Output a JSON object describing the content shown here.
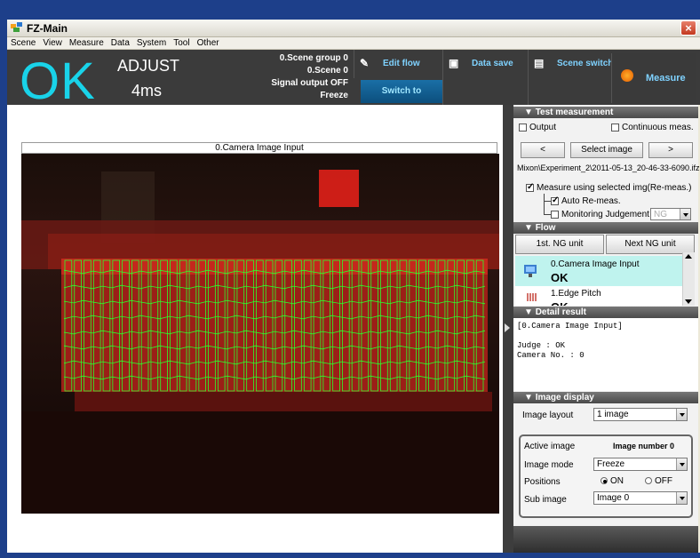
{
  "window": {
    "title": "FZ-Main",
    "close": "×"
  },
  "menu": [
    "Scene",
    "View",
    "Measure",
    "Data",
    "System",
    "Tool",
    "Other"
  ],
  "toolbar": {
    "result": "OK",
    "mode": "ADJUST",
    "time": "4ms",
    "scene_group": "0.Scene group 0",
    "scene": "0.Scene 0",
    "signal_output": "Signal output OFF",
    "freeze": "Freeze",
    "edit_flow": "Edit flow",
    "data_save": "Data save",
    "scene_switch": "Scene switch",
    "measure": "Measure",
    "run_mode": "Switch to RUNmode",
    "result_color": "#19d3e9"
  },
  "image": {
    "header": "0.Camera Image Input"
  },
  "test_measurement": {
    "title": "Test measurement",
    "output_label": "Output",
    "continuous_label": "Continuous meas.",
    "prev": "<",
    "select_image": "Select image",
    "next": ">",
    "path": "Mixon\\Experiment_2\\2011-05-13_20-46-33-6090.ifz",
    "measure_selected": "Measure using selected img(Re-meas.)",
    "auto_remeas": "Auto Re-meas.",
    "monitoring": "Monitoring Judgement",
    "monitoring_value": "NG"
  },
  "flow": {
    "title": "Flow",
    "first_ng": "1st. NG unit",
    "next_ng": "Next NG unit",
    "items": [
      {
        "name": "0.Camera Image Input",
        "status": "OK"
      },
      {
        "name": "1.Edge Pitch",
        "status": "OK"
      }
    ]
  },
  "detail": {
    "title": "Detail result",
    "lines": "[0.Camera Image Input]\n\nJudge : OK\nCamera No. : 0"
  },
  "image_display": {
    "title": "Image display",
    "layout_label": "Image layout",
    "layout_value": "1 image",
    "active_label": "Active image",
    "active_value": "Image number 0",
    "mode_label": "Image mode",
    "mode_value": "Freeze",
    "positions_label": "Positions",
    "on": "ON",
    "off": "OFF",
    "sub_label": "Sub image",
    "sub_value": "Image 0"
  }
}
